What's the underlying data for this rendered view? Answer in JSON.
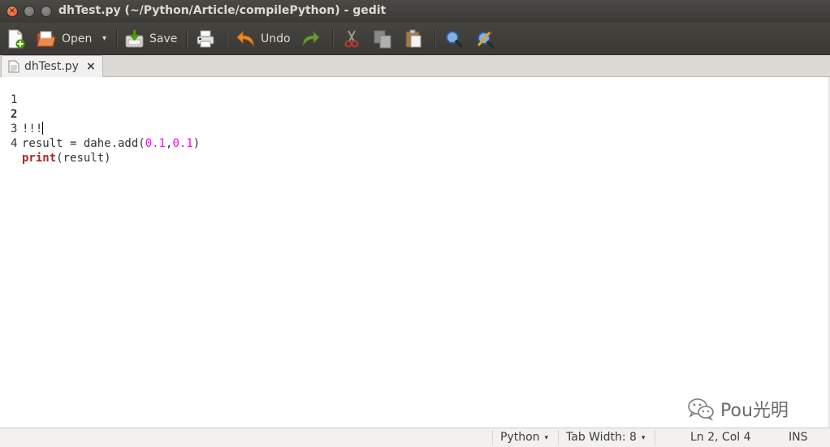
{
  "window": {
    "title": "dhTest.py (~/Python/Article/compilePython) - gedit",
    "close_glyph": "×",
    "minimize_glyph": "–",
    "maximize_glyph": "□"
  },
  "toolbar": {
    "new_icon": "new-document-icon",
    "open_label": "Open",
    "open_dropdown": "▾",
    "save_label": "Save",
    "print_icon": "print-icon",
    "undo_label": "Undo",
    "redo_icon": "redo-icon",
    "cut_icon": "cut-icon",
    "copy_icon": "copy-icon",
    "paste_icon": "paste-icon",
    "find_icon": "search-icon",
    "replace_icon": "find-replace-icon"
  },
  "tabs": [
    {
      "label": "dhTest.py",
      "close": "×"
    }
  ],
  "editor": {
    "lines": [
      {
        "number": "1",
        "text": ""
      },
      {
        "number": "2",
        "text": "!!!"
      },
      {
        "number": "3",
        "pre": "result = dahe.add(",
        "num1": "0.1",
        "comma": ",",
        "num2": "0.1",
        "post": ")"
      },
      {
        "number": "4",
        "kw": "print",
        "rest": "(result)"
      }
    ],
    "current_line": 2
  },
  "watermark": {
    "text": "Pou光明"
  },
  "statusbar": {
    "language": "Python",
    "tab_width": "Tab Width: 8",
    "position": "Ln 2, Col 4",
    "mode": "INS",
    "dropdown_glyph": "▾"
  }
}
